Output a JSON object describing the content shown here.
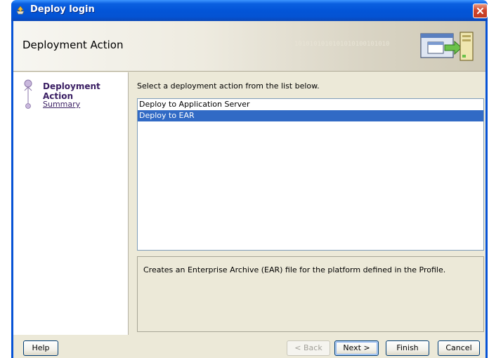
{
  "window": {
    "title": "Deploy login",
    "close_icon": "close-icon"
  },
  "header": {
    "title": "Deployment Action",
    "decoration": "1010101010101010100101010",
    "graphic_icon": "deploy-windows-icon"
  },
  "steps": {
    "items": [
      {
        "label": "Deployment Action",
        "state": "current"
      },
      {
        "label": "Summary",
        "state": "pending"
      }
    ]
  },
  "main": {
    "instruction": "Select a deployment action from the list below.",
    "actions": [
      {
        "label": "Deploy to Application Server",
        "selected": false
      },
      {
        "label": "Deploy to EAR",
        "selected": true
      }
    ],
    "description": "Creates an Enterprise Archive (EAR) file for the platform defined in the Profile."
  },
  "buttons": {
    "help": "Help",
    "back": "< Back",
    "next": "Next >",
    "finish": "Finish",
    "cancel": "Cancel"
  },
  "colors": {
    "titlebar": "#0355d8",
    "selection": "#316ac5",
    "step_text": "#3a1e63"
  }
}
